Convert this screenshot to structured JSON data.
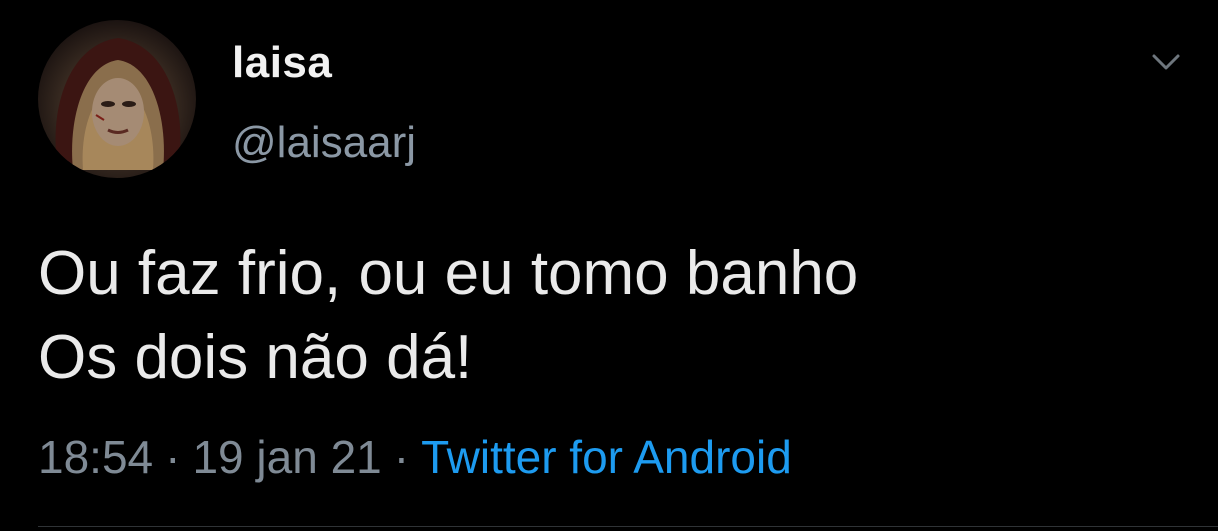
{
  "user": {
    "display_name": "laisa",
    "handle": "@laisaarj"
  },
  "tweet": {
    "text": "Ou faz frio, ou eu tomo banho\nOs dois não dá!",
    "time": "18:54",
    "date": "19 jan 21",
    "separator": "·",
    "source": "Twitter for Android"
  },
  "icons": {
    "avatar": "profile-photo",
    "menu": "chevron-down-icon"
  },
  "colors": {
    "background": "#000000",
    "text": "#eaeaea",
    "secondary": "#7f8a95",
    "link": "#1d9bf0"
  }
}
